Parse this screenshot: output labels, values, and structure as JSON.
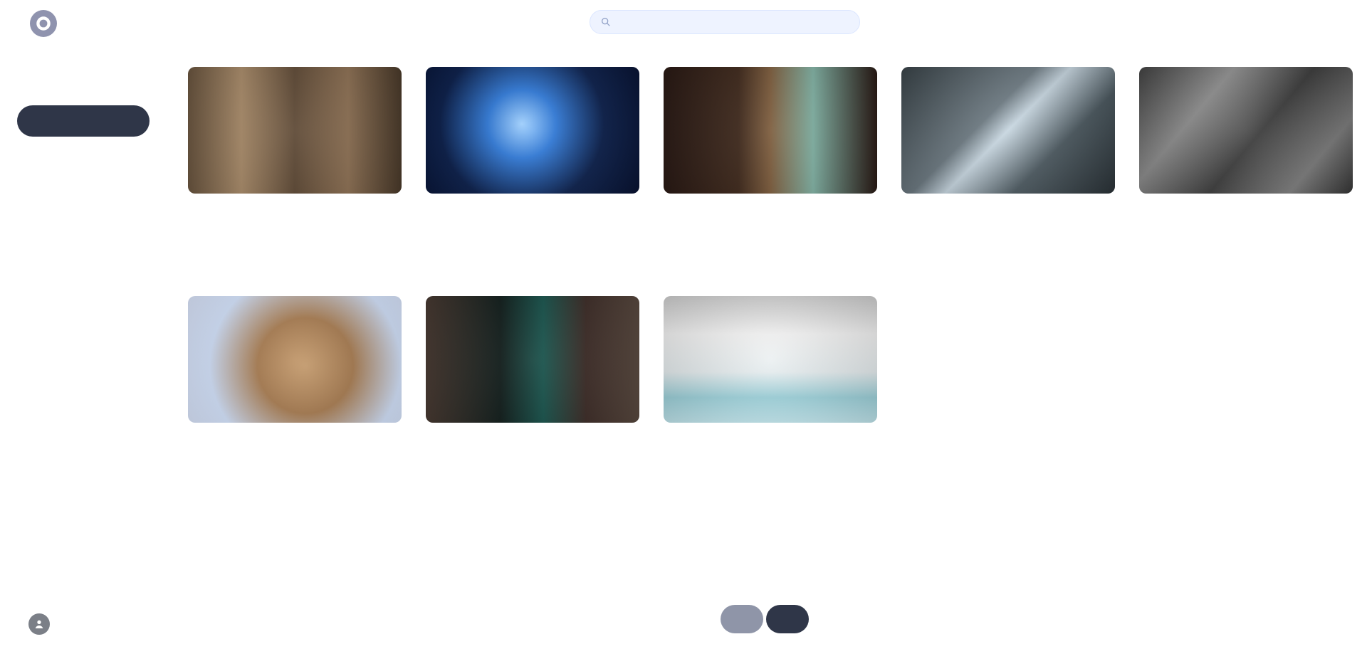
{
  "app": {
    "logo_text": "",
    "brand_color": "#2f3648"
  },
  "search": {
    "placeholder": "",
    "value": ""
  },
  "sidebar": {
    "text": "",
    "button_label": ""
  },
  "videos": [
    {
      "title": "",
      "channel": "",
      "duration": ""
    },
    {
      "title": "",
      "channel": "",
      "duration": ""
    },
    {
      "title": "",
      "channel": "",
      "duration": ""
    },
    {
      "title": "",
      "channel": "",
      "duration": ""
    },
    {
      "title": "",
      "channel": "",
      "duration": ""
    },
    {
      "title": "",
      "channel": "",
      "duration": ""
    },
    {
      "title": "",
      "channel": "",
      "duration": ""
    },
    {
      "title": "",
      "channel": "",
      "duration": ""
    }
  ],
  "footer": {
    "left_text": "",
    "left_icon": "user-icon"
  },
  "pagination": {
    "prev_label": "",
    "next_label": ""
  }
}
